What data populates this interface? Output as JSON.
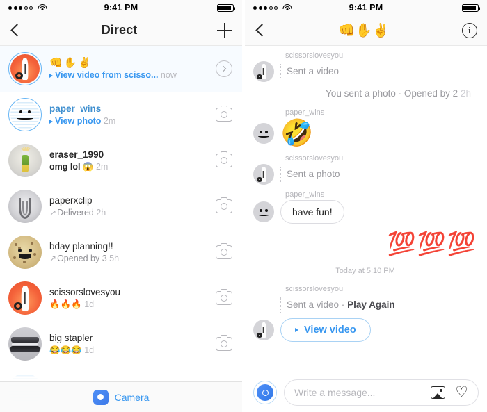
{
  "status_bar": {
    "signal_dots_filled": 3,
    "signal_dots_total": 5,
    "wifi_icon": "wifi-icon",
    "time": "9:41 PM",
    "battery_icon": "battery-icon"
  },
  "left_panel": {
    "nav": {
      "back_icon": "chevron-left-icon",
      "title": "Direct",
      "new_message_icon": "plus-icon"
    },
    "threads": [
      {
        "name": "👊✋✌️",
        "name_style": "emoji",
        "preview": "View video from scisso...",
        "preview_style": "blue-play",
        "time": "now",
        "unread": true,
        "ring": true,
        "avatar": "scissors",
        "action_icon": "chevron-right-circle-icon"
      },
      {
        "name": "paper_wins",
        "name_style": "blue",
        "preview": "View photo",
        "preview_style": "blue-play",
        "time": "2m",
        "unread": true,
        "ring": true,
        "avatar": "paper",
        "action_icon": "camera-icon"
      },
      {
        "name": "eraser_1990",
        "name_style": "bold",
        "preview": "omg lol 😱",
        "preview_style": "bold",
        "time": "2m",
        "unread": true,
        "ring": false,
        "avatar": "eraser",
        "action_icon": "camera-icon"
      },
      {
        "name": "paperxclip",
        "name_style": "normal",
        "preview": "Delivered",
        "preview_style": "sent-arrow",
        "time": "2h",
        "unread": false,
        "ring": false,
        "avatar": "clip",
        "action_icon": "camera-icon"
      },
      {
        "name": "bday planning!!",
        "name_style": "normal",
        "preview": "Opened by 3",
        "preview_style": "sent-arrow",
        "time": "5h",
        "unread": false,
        "ring": false,
        "avatar": "cookie",
        "action_icon": "camera-icon"
      },
      {
        "name": "scissorslovesyou",
        "name_style": "normal",
        "preview": "🔥🔥🔥",
        "preview_style": "normal",
        "time": "1d",
        "unread": false,
        "ring": false,
        "avatar": "scissors",
        "action_icon": "camera-icon"
      },
      {
        "name": "big stapler",
        "name_style": "normal",
        "preview": "😂😂😂",
        "preview_style": "normal",
        "time": "1d",
        "unread": false,
        "ring": false,
        "avatar": "stapler",
        "action_icon": "camera-icon"
      }
    ],
    "camera_bar": {
      "icon": "camera-icon",
      "label": "Camera"
    }
  },
  "right_panel": {
    "nav": {
      "back_icon": "chevron-left-icon",
      "title": "👊✋✌️",
      "info_icon": "info-circle-icon"
    },
    "messages": [
      {
        "kind": "incoming-media",
        "sender": "scissorslovesyou",
        "text": "Sent a video",
        "avatar": "scissors"
      },
      {
        "kind": "outgoing-status",
        "text": "You sent a photo · Opened by 2",
        "time": "2h"
      },
      {
        "kind": "incoming-emoji",
        "sender": "paper_wins",
        "emoji": "🤣",
        "avatar": "paper"
      },
      {
        "kind": "incoming-media",
        "sender": "scissorslovesyou",
        "text": "Sent a photo",
        "avatar": "scissors"
      },
      {
        "kind": "incoming-bubble",
        "sender": "paper_wins",
        "text": "have fun!",
        "avatar": "paper"
      },
      {
        "kind": "outgoing-emoji",
        "emoji": "💯💯💯"
      },
      {
        "kind": "day-divider",
        "text": "Today at 5:10 PM"
      },
      {
        "kind": "incoming-video",
        "sender": "scissorslovesyou",
        "text": "Sent a video · ",
        "text_bold": "Play Again",
        "button_label": "View video",
        "avatar": "scissors"
      }
    ],
    "composer": {
      "camera_icon": "camera-icon",
      "placeholder": "Write a message...",
      "photo_icon": "photo-library-icon",
      "heart_icon": "heart-icon"
    }
  },
  "colors": {
    "accent_blue": "#3897f0",
    "link_blue": "#3f8fcf",
    "text_dark": "#262626",
    "text_muted": "#8e8e93",
    "bg": "#ffffff",
    "nav_bg": "#fafafa"
  }
}
